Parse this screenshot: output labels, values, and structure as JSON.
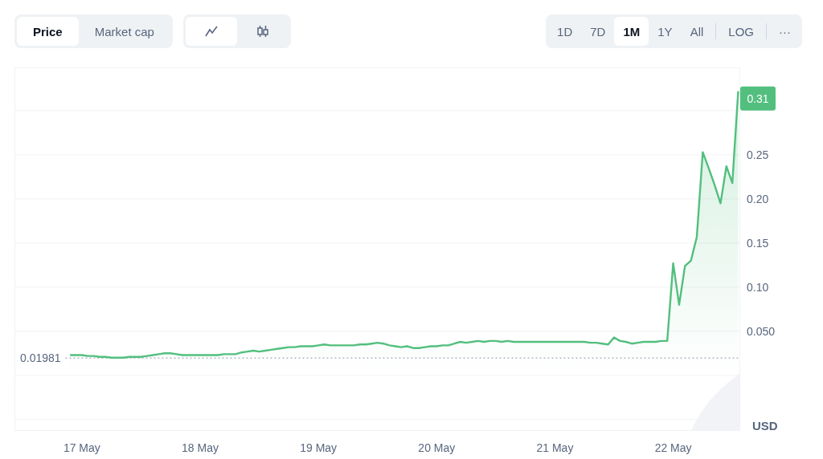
{
  "toolbar": {
    "metric_tabs": [
      {
        "label": "Price",
        "selected": true
      },
      {
        "label": "Market cap",
        "selected": false
      }
    ],
    "chart_types": [
      {
        "kind": "line",
        "selected": true
      },
      {
        "kind": "candle",
        "selected": false
      }
    ],
    "ranges": [
      {
        "label": "1D",
        "selected": false
      },
      {
        "label": "7D",
        "selected": false
      },
      {
        "label": "1M",
        "selected": true
      },
      {
        "label": "1Y",
        "selected": false
      },
      {
        "label": "All",
        "selected": false
      }
    ],
    "log_button": {
      "label": "LOG",
      "selected": false
    },
    "more_button": {
      "label": "···"
    }
  },
  "chart": {
    "current_badge": "0.31",
    "unit": "USD",
    "chart_data": {
      "type": "area",
      "ylim": [
        -0.062,
        0.349
      ],
      "grid": true,
      "ref_lines": [
        {
          "axis": "y",
          "value": 0.01981,
          "label": "0.01981"
        }
      ],
      "categories": [
        null,
        null,
        "17 May",
        null,
        null,
        null,
        null,
        null,
        null,
        null,
        null,
        null,
        null,
        null,
        null,
        null,
        null,
        null,
        null,
        null,
        null,
        null,
        "18 May",
        null,
        null,
        null,
        null,
        null,
        null,
        null,
        null,
        null,
        null,
        null,
        null,
        null,
        null,
        null,
        null,
        null,
        null,
        null,
        "19 May",
        null,
        null,
        null,
        null,
        null,
        null,
        null,
        null,
        null,
        null,
        null,
        null,
        null,
        null,
        null,
        null,
        null,
        null,
        null,
        "20 May",
        null,
        null,
        null,
        null,
        null,
        null,
        null,
        null,
        null,
        null,
        null,
        null,
        null,
        null,
        null,
        null,
        null,
        null,
        null,
        "21 May",
        null,
        null,
        null,
        null,
        null,
        null,
        null,
        null,
        null,
        null,
        null,
        null,
        null,
        null,
        null,
        null,
        null,
        null,
        null,
        "22 May",
        null,
        null,
        null,
        null,
        null,
        null,
        null,
        null,
        null,
        null,
        null
      ],
      "yticks": [
        {
          "value": 0.05,
          "label": "0.050"
        },
        {
          "value": 0.1,
          "label": "0.10"
        },
        {
          "value": 0.15,
          "label": "0.15"
        },
        {
          "value": 0.2,
          "label": "0.20"
        },
        {
          "value": 0.25,
          "label": "0.25"
        }
      ],
      "series": [
        {
          "color": "#52bf7e",
          "values": [
            0.023,
            0.023,
            0.023,
            0.022,
            0.022,
            0.021,
            0.021,
            0.02,
            0.02,
            0.02,
            0.021,
            0.021,
            0.021,
            0.022,
            0.023,
            0.024,
            0.025,
            0.025,
            0.024,
            0.023,
            0.023,
            0.023,
            0.023,
            0.023,
            0.023,
            0.023,
            0.024,
            0.024,
            0.024,
            0.026,
            0.027,
            0.028,
            0.027,
            0.028,
            0.029,
            0.03,
            0.031,
            0.032,
            0.032,
            0.033,
            0.033,
            0.033,
            0.034,
            0.035,
            0.034,
            0.034,
            0.034,
            0.034,
            0.034,
            0.035,
            0.035,
            0.036,
            0.037,
            0.036,
            0.034,
            0.033,
            0.032,
            0.033,
            0.031,
            0.031,
            0.032,
            0.033,
            0.033,
            0.034,
            0.034,
            0.036,
            0.038,
            0.037,
            0.038,
            0.039,
            0.038,
            0.039,
            0.039,
            0.038,
            0.039,
            0.038,
            0.038,
            0.038,
            0.038,
            0.038,
            0.038,
            0.038,
            0.038,
            0.038,
            0.038,
            0.038,
            0.038,
            0.038,
            0.037,
            0.037,
            0.036,
            0.035,
            0.043,
            0.039,
            0.038,
            0.036,
            0.037,
            0.038,
            0.038,
            0.038,
            0.039,
            0.039,
            0.127,
            0.08,
            0.124,
            0.13,
            0.157,
            0.253,
            0.235,
            0.216,
            0.195,
            0.237,
            0.218,
            0.322
          ]
        }
      ]
    }
  }
}
